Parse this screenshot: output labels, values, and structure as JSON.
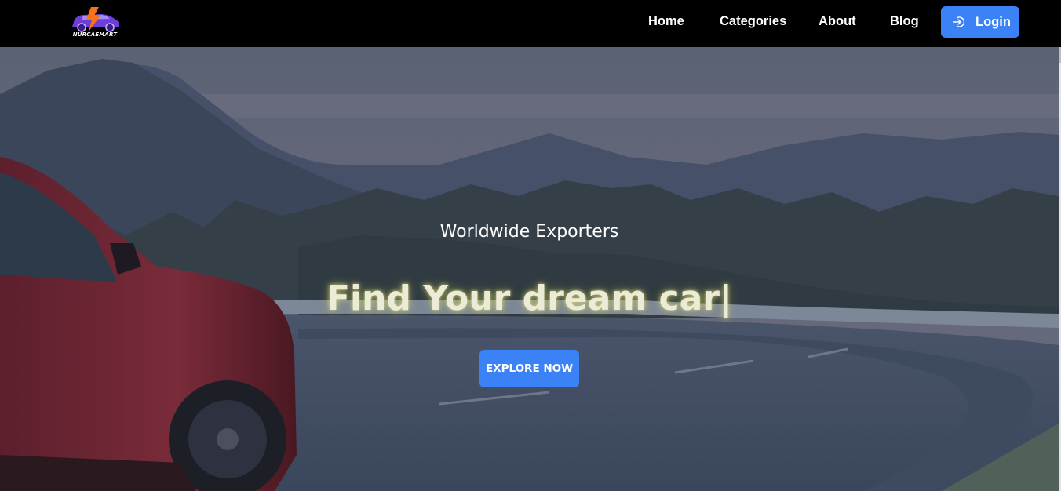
{
  "brand": {
    "name": "NURCAEMART"
  },
  "nav": {
    "items": [
      {
        "label": "Home"
      },
      {
        "label": "Categories"
      },
      {
        "label": "About"
      },
      {
        "label": "Blog"
      }
    ],
    "login_label": "Login"
  },
  "hero": {
    "tagline": "Worldwide Exporters",
    "headline": "Find Your dream car|",
    "cta_label": "EXPLORE NOW"
  },
  "colors": {
    "navbar": "#000000",
    "accent": "#3b82f6",
    "headline_glow": "#e8e878"
  },
  "icons": {
    "login": "sign-in-icon",
    "logo": "car-lightning-logo"
  }
}
